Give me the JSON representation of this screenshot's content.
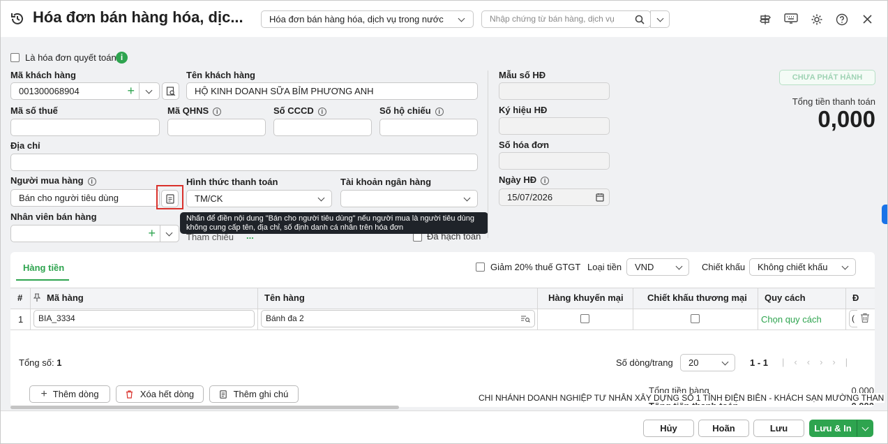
{
  "header": {
    "title": "Hóa đơn bán hàng hóa, dịc...",
    "type_select": "Hóa đơn bán hàng hóa, dịch vụ trong nước",
    "search_placeholder": "Nhập chứng từ bán hàng, dịch vụ"
  },
  "form": {
    "final_invoice_label": "Là hóa đơn quyết toán",
    "customer_code_label": "Mã khách hàng",
    "customer_code_value": "001300068904",
    "customer_name_label": "Tên khách hàng",
    "customer_name_value": "HỘ KINH DOANH SỮA BỈM PHƯƠNG ANH",
    "tax_code_label": "Mã số thuế",
    "qhns_label": "Mã QHNS",
    "cccd_label": "Số CCCD",
    "passport_label": "Số hộ chiếu",
    "address_label": "Địa chỉ",
    "buyer_label": "Người mua hàng",
    "buyer_value": "Bán cho người tiêu dùng",
    "payment_label": "Hình thức thanh toán",
    "payment_value": "TM/CK",
    "bank_label": "Tài khoản ngân hàng",
    "salesperson_label": "Nhân viên bán hàng",
    "reference_label": "Tham chiếu",
    "reference_value": "...",
    "accounted_label": "Đã hạch toán"
  },
  "tooltip": {
    "line1": "Nhấn để điền nội dung \"Bán cho người tiêu dùng\" nếu người mua là người tiêu dùng",
    "line2": "không cung cấp tên, địa chỉ, số định danh cá nhân trên hóa đơn"
  },
  "invoice_info": {
    "template_label": "Mẫu số HĐ",
    "symbol_label": "Ký hiệu HĐ",
    "number_label": "Số hóa đơn",
    "date_label": "Ngày HĐ",
    "date_value": "15/07/2026",
    "status_badge": "CHƯA PHÁT HÀNH",
    "total_label": "Tổng tiền thanh toán",
    "total_value": "0,000"
  },
  "detail": {
    "tab": "Hàng tiền",
    "vat_reduction_label": "Giảm 20% thuế GTGT",
    "currency_label": "Loại tiền",
    "currency_value": "VND",
    "discount_label": "Chiết khấu",
    "discount_value": "Không chiết khấu",
    "columns": [
      "#",
      "Mã hàng",
      "Tên hàng",
      "Hàng khuyến mại",
      "Chiết khấu thương mại",
      "Quy cách",
      "Đ"
    ],
    "rows": [
      {
        "index": "1",
        "code": "BIA_3334",
        "name": "Bánh đa 2",
        "spec": "Chọn quy cách",
        "extra": "("
      }
    ],
    "total_count_label": "Tổng số:",
    "total_count_value": "1",
    "rows_per_page_label": "Số dòng/trang",
    "rows_per_page_value": "20",
    "page_range": "1 - 1",
    "add_row": "Thêm dòng",
    "delete_rows": "Xóa hết dòng",
    "add_note": "Thêm ghi chú",
    "summary_label": "Tổng tiền hàng",
    "summary_value": "0,000",
    "summary_label2": "Tổng tiền thanh toán",
    "summary_value2": "0,000"
  },
  "marquee": "CHI NHÁNH DOANH NGHIỆP TƯ NHÂN XÂY DỰNG SỐ 1 TỈNH ĐIỆN BIÊN - KHÁCH SẠN MƯỜNG THANH CẦN THƠ",
  "footer": {
    "cancel": "Hủy",
    "revert": "Hoãn",
    "save": "Lưu",
    "save_print": "Lưu & In"
  },
  "colors": {
    "accent": "#2ea44f",
    "badge_text": "#9fd3b4",
    "tooltip_bg": "#1f2329",
    "highlight_border": "#d9312b"
  }
}
